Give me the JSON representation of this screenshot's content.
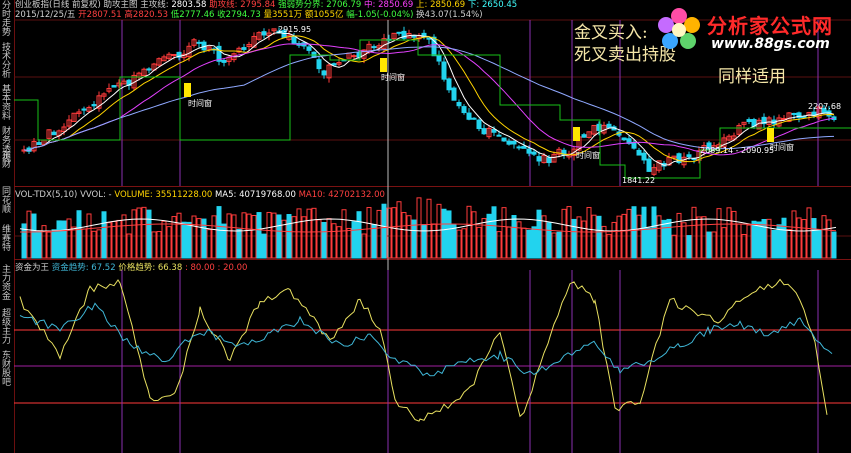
{
  "left_tabs": [
    "分时走势",
    "技术分析",
    "基本资料",
    "财务透视",
    "东财",
    "同花顺",
    "维赛特",
    "主力资金",
    "超级主力",
    "东财股吧"
  ],
  "header": {
    "main_prefix": "创业板指(日线 前复权) 助攻主图 主攻线:",
    "main_val": "2803.58",
    "help_label": "助攻线:",
    "help_val": "2795.84",
    "strong_label": "强弱势分界:",
    "strong_val": "2706.79",
    "mid_label": "中:",
    "mid_val": "2850.69",
    "up_label": "上:",
    "up_val": "2850.69",
    "dn_label": "下:",
    "dn_val": "2650.45"
  },
  "header2": {
    "date": "2015/12/25/五",
    "open": "开2807.51",
    "high": "高2820.53",
    "low": "低2777.46",
    "close": "收2794.73",
    "vol": "量3551万",
    "amt": "额1055亿",
    "chg": "幅-1.05(-0.04%)",
    "turn": "换43.07(1.54%)"
  },
  "vol_header": {
    "name": "VOL-TDX(5,10)",
    "vvol": "VVOL: -",
    "volume_label": "VOLUME: 35511228.00",
    "ma5_label": "MA5: 40719768.00",
    "ma10_label": "MA10: 42702132.00"
  },
  "ind_header": {
    "name": "资金为王",
    "trend_label": "资金趋势: 67.52",
    "price_label": "价格趋势: 66.38",
    "l1": ": 80.00",
    "l2": ": 20.00"
  },
  "annotations": {
    "peak1": "2915.95",
    "peak2": "2207.68",
    "range": "2089.14 - 2090.95",
    "low_mark": "1841.22",
    "time_window": "时间窗"
  },
  "overlay": {
    "line1": "金叉买入:",
    "line2": "死叉卖出持股",
    "line3": "同样适用"
  },
  "logo": {
    "title": "分析家公式网",
    "url": "www.88gs.com"
  },
  "colors": {
    "up": "#ff3b3b",
    "down": "#22d3ee",
    "ma5": "#ffffff",
    "ma10": "#ffd400",
    "ma20": "#e040fb",
    "ma60": "#8fa8ff",
    "green_line": "#18c018",
    "yellow_curve": "#e8e060",
    "cyan_curve": "#3fb6d6"
  }
}
